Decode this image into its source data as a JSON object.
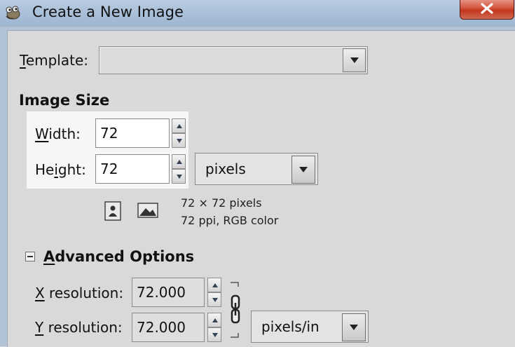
{
  "window": {
    "title": "Create a New Image",
    "app_icon": "gimp-icon",
    "close_icon": "close-icon"
  },
  "template": {
    "label_prefix": "",
    "label_accel": "T",
    "label_rest": "emplate:",
    "value": ""
  },
  "image_size": {
    "heading": "Image Size",
    "width_accel": "W",
    "width_rest": "idth:",
    "width_value": "72",
    "height_before": "He",
    "height_accel": "i",
    "height_rest": "ght:",
    "height_value": "72",
    "unit": "pixels",
    "portrait_icon": "portrait-icon",
    "landscape_icon": "landscape-icon",
    "info_size": "72 × 72 pixels",
    "info_res": "72 ppi, RGB color"
  },
  "advanced": {
    "heading_accel": "A",
    "heading_rest": "dvanced Options",
    "x_accel": "X",
    "x_rest": " resolution:",
    "x_value": "72.000",
    "y_accel": "Y",
    "y_rest": " resolution:",
    "y_value": "72.000",
    "res_unit": "pixels/in",
    "chain_icon": "chain-link-icon"
  },
  "colors": {
    "background": "#d9d9d9",
    "highlight": "#f6f6f6",
    "titlebar": "#a9bfd8",
    "close_button": "#c3361f"
  }
}
